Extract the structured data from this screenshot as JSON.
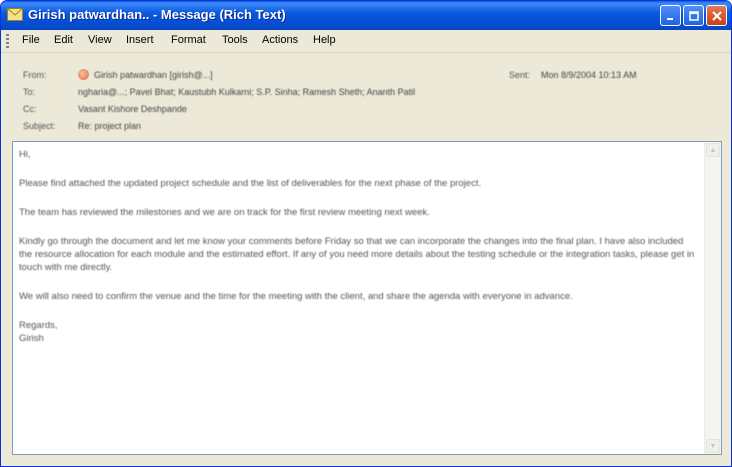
{
  "window": {
    "title": "Girish patwardhan.. - Message (Rich Text)"
  },
  "menu": {
    "items": [
      "File",
      "Edit",
      "View",
      "Insert",
      "Format",
      "Tools",
      "Actions",
      "Help"
    ]
  },
  "header": {
    "from_label": "From:",
    "from_value": "Girish patwardhan [girish@...]",
    "sent_label": "Sent:",
    "sent_value": "Mon 8/9/2004 10:13 AM",
    "to_label": "To:",
    "to_value": "ngharia@...; Pavel Bhat; Kaustubh Kulkarni; S.P. Sinha; Ramesh Sheth; Ananth Patil",
    "cc_label": "Cc:",
    "cc_value": "Vasant Kishore Deshpande",
    "subject_label": "Subject:",
    "subject_value": "Re: project plan"
  },
  "body": {
    "paragraphs": [
      "Hi,",
      "Please find attached the updated project schedule and the list of deliverables for the next phase of the project.",
      "The team has reviewed the milestones and we are on track for the first review meeting next week.",
      "Kindly go through the document and let me know your comments before Friday so that we can incorporate the changes into the final plan. I have also included the resource allocation for each module and the estimated effort. If any of you need more details about the testing schedule or the integration tasks, please get in touch with me directly.",
      "We will also need to confirm the venue and the time for the meeting with the client, and share the agenda with everyone in advance.",
      "Regards,\nGirish"
    ]
  },
  "colors": {
    "titlebar": "#0a5fe6",
    "frame": "#ece9d8",
    "close_button": "#c4401a"
  },
  "icons": {
    "title": "envelope-icon",
    "minimize": "minimize-icon",
    "maximize": "maximize-icon",
    "close": "close-icon"
  }
}
